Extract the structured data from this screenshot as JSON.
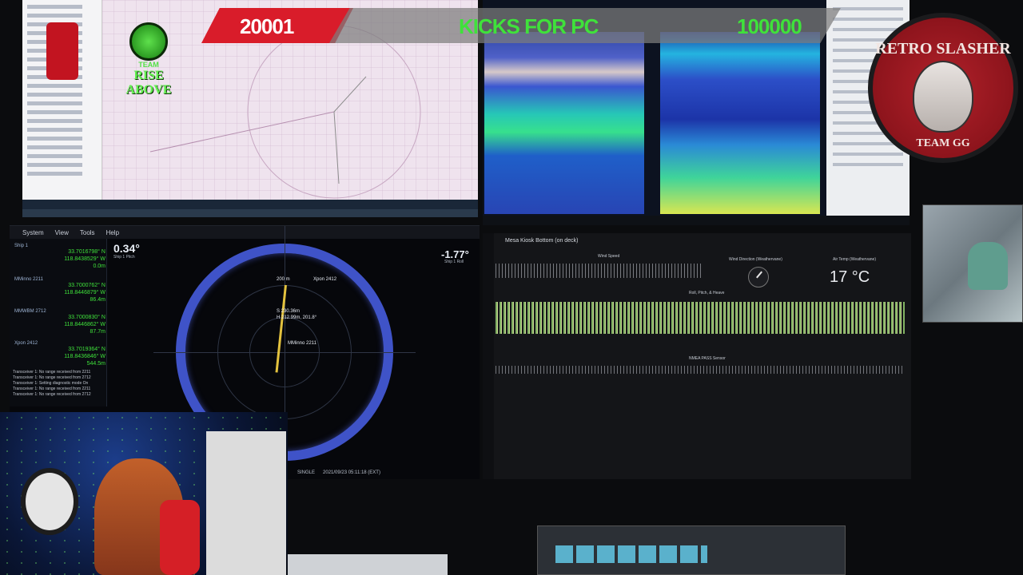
{
  "banner": {
    "left_value": "20001",
    "center_text": "KICKS FOR PC",
    "right_value": "100000"
  },
  "logos": {
    "team_rise_above": {
      "line1": "TEAM",
      "line2": "RISE ABOVE"
    },
    "retro_slasher": {
      "top": "RETRO SLASHER",
      "bottom": "TEAM GG"
    }
  },
  "navigation_app": {
    "menu": [
      "System",
      "View",
      "Tools",
      "Help"
    ],
    "heading_left": "0.34°",
    "heading_left_label": "Ship 1 Pitch",
    "heading_right": "-1.77°",
    "heading_right_label": "Ship 1 Roll",
    "ships": [
      {
        "name": "Ship 1",
        "lat": "33.7016798° N",
        "lon": "118.8438529° W",
        "depth": "0.0m"
      },
      {
        "name": "MMinno 2211",
        "lat": "33.7000762° N",
        "lon": "118.8446879° W",
        "depth": "86.4m"
      },
      {
        "name": "MMWBM 2712",
        "lat": "33.7000830° N",
        "lon": "118.8446862° W",
        "depth": "87.7m"
      },
      {
        "name": "Xpon 2412",
        "lat": "33.7019364° N",
        "lon": "118.8436846° W",
        "depth": "544.5m"
      }
    ],
    "sonar_labels": {
      "range": "200 m",
      "target": "Xpon 2412",
      "slant": "S 230.36m",
      "horizontal": "H 212.99m, 201.8°",
      "ship": "MMinno 2211"
    },
    "log": [
      "Transceiver 1: No range received from 2211",
      "Transceiver 1: No range received from 2712",
      "Transceiver 1: Setting diagnostic mode On",
      "Transceiver 1: No range received from 2211",
      "Transceiver 1: No range received from 2712"
    ],
    "status": {
      "mode": "SINGLE",
      "timestamp": "2021/09/23 05:11:18 (EXT)"
    }
  },
  "dashboard": {
    "title": "Mesa Kiosk Bottom (on deck)",
    "wind_speed_label": "Wind Speed",
    "wind_direction_label": "Wind Direction (Weathervane)",
    "air_temp_label": "Air Temp (Weathervane)",
    "air_temp": "17 °C",
    "roll_pitch_heave_label": "Roll, Pitch, & Heave",
    "nmea_label": "NMEA PASS Sensor"
  }
}
